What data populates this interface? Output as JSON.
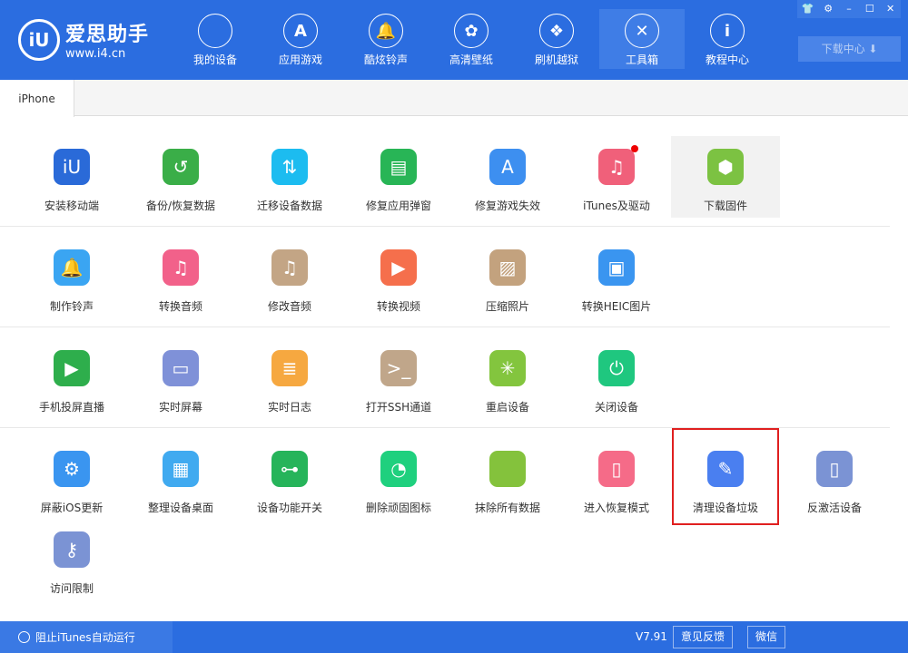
{
  "app": {
    "name": "爱思助手",
    "url": "www.i4.cn"
  },
  "nav": [
    {
      "label": "我的设备",
      "icon": "apple-icon",
      "glyph": ""
    },
    {
      "label": "应用游戏",
      "icon": "app-store-icon",
      "glyph": "A"
    },
    {
      "label": "酷炫铃声",
      "icon": "bell-icon",
      "glyph": "🔔"
    },
    {
      "label": "高清壁纸",
      "icon": "flower-icon",
      "glyph": "✿"
    },
    {
      "label": "刷机越狱",
      "icon": "box-icon",
      "glyph": "❖"
    },
    {
      "label": "工具箱",
      "icon": "tools-icon",
      "glyph": "✕",
      "active": true
    },
    {
      "label": "教程中心",
      "icon": "info-icon",
      "glyph": "i"
    }
  ],
  "window": {
    "skin": "👕",
    "settings": "⚙",
    "minimize": "–",
    "maximize": "☐",
    "close": "✕"
  },
  "download_center": "下载中心 ⬇",
  "tab": "iPhone",
  "tools": [
    [
      {
        "label": "安装移动端",
        "color": "#2a6ad8",
        "g": "iU"
      },
      {
        "label": "备份/恢复数据",
        "color": "#3aae48",
        "g": "↺"
      },
      {
        "label": "迁移设备数据",
        "color": "#1cbcf0",
        "g": "⇅"
      },
      {
        "label": "修复应用弹窗",
        "color": "#28b556",
        "g": "▤"
      },
      {
        "label": "修复游戏失效",
        "color": "#3d8ff0",
        "g": "A"
      },
      {
        "label": "iTunes及驱动",
        "color": "#f0607a",
        "g": "♫",
        "badge": true
      },
      {
        "label": "下载固件",
        "color": "#7cc242",
        "g": "⬢",
        "highlight": true
      }
    ],
    [
      {
        "label": "制作铃声",
        "color": "#3aa5f2",
        "g": "🔔"
      },
      {
        "label": "转换音频",
        "color": "#f2618a",
        "g": "♫"
      },
      {
        "label": "修改音频",
        "color": "#c3a585",
        "g": "♫"
      },
      {
        "label": "转换视频",
        "color": "#f56f4c",
        "g": "▶"
      },
      {
        "label": "压缩照片",
        "color": "#c3a27e",
        "g": "▨"
      },
      {
        "label": "转换HEIC图片",
        "color": "#3a95f0",
        "g": "▣"
      }
    ],
    [
      {
        "label": "手机投屏直播",
        "color": "#2eae4c",
        "g": "▶"
      },
      {
        "label": "实时屏幕",
        "color": "#7f91d8",
        "g": "▭"
      },
      {
        "label": "实时日志",
        "color": "#f6a840",
        "g": "≣"
      },
      {
        "label": "打开SSH通道",
        "color": "#c0a68a",
        "g": ">_"
      },
      {
        "label": "重启设备",
        "color": "#83c53e",
        "g": "✳"
      },
      {
        "label": "关闭设备",
        "color": "#1fc77f",
        "g": "⏻"
      }
    ],
    [
      {
        "label": "屏蔽iOS更新",
        "color": "#3a95f0",
        "g": "⚙"
      },
      {
        "label": "整理设备桌面",
        "color": "#40aaf0",
        "g": "▦"
      },
      {
        "label": "设备功能开关",
        "color": "#26b45a",
        "g": "⊶"
      },
      {
        "label": "删除顽固图标",
        "color": "#1fd07e",
        "g": "◔"
      },
      {
        "label": "抹除所有数据",
        "color": "#84c23c",
        "g": ""
      },
      {
        "label": "进入恢复模式",
        "color": "#f56b88",
        "g": "▯"
      },
      {
        "label": "清理设备垃圾",
        "color": "#4a7ff0",
        "g": "✎",
        "selected": true
      },
      {
        "label": "反激活设备",
        "color": "#7b93d4",
        "g": "▯"
      }
    ],
    [
      {
        "label": "访问限制",
        "color": "#7b93d4",
        "g": "⚷"
      }
    ]
  ],
  "footer": {
    "itunes": "阻止iTunes自动运行",
    "version": "V7.91",
    "feedback": "意见反馈",
    "wechat": "微信"
  }
}
